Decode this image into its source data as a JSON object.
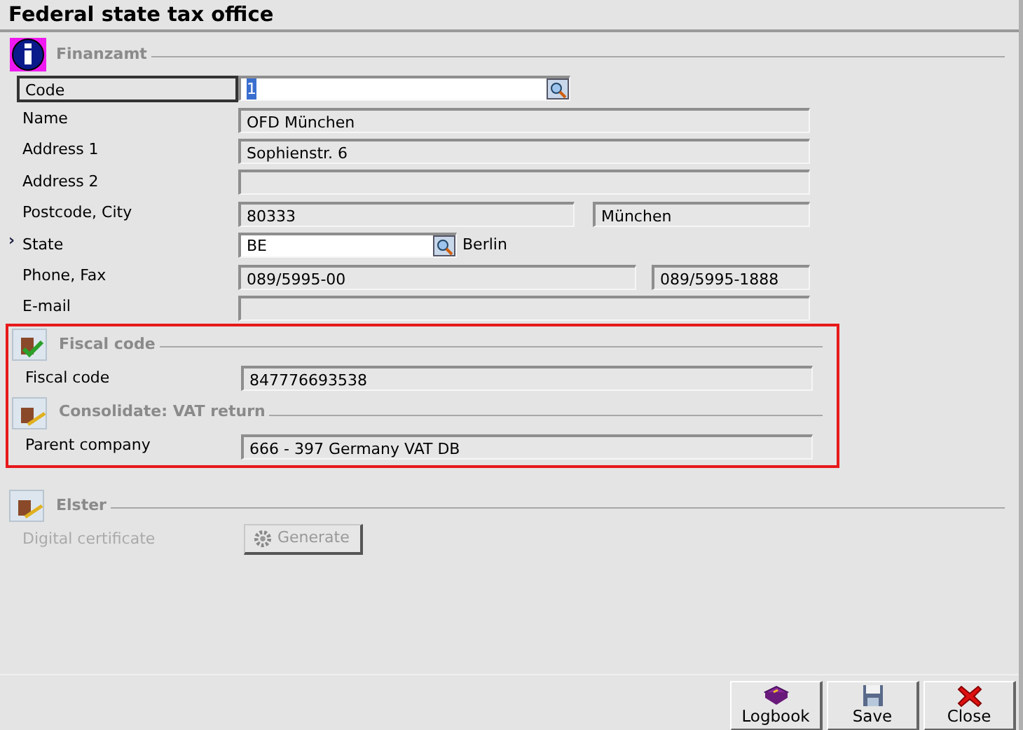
{
  "window": {
    "title": "Federal state tax office"
  },
  "sections": [
    {
      "title": "Finanzamt",
      "kind": "info",
      "highlighted": false,
      "rows": [
        {
          "label": "Code",
          "focused": true,
          "fields": [
            {
              "kind": "lookup",
              "value": "1",
              "text_selected": true
            }
          ]
        },
        {
          "label": "Name",
          "focused": false,
          "fields": [
            {
              "kind": "text",
              "value": "OFD München"
            }
          ]
        },
        {
          "label": "Address 1",
          "focused": false,
          "fields": [
            {
              "kind": "text",
              "value": "Sophienstr. 6"
            }
          ]
        },
        {
          "label": "Address 2",
          "focused": false,
          "fields": [
            {
              "kind": "text"
            }
          ]
        },
        {
          "label": "Postcode, City",
          "focused": false,
          "fields": [
            {
              "kind": "text",
              "value": "80333"
            },
            {
              "kind": "wide-second",
              "value": "München"
            }
          ]
        },
        {
          "label": "State",
          "marker": "›",
          "focused": false,
          "fields": [
            {
              "kind": "lookup-short",
              "value": "BE",
              "text_selected": false
            },
            {
              "kind": "description",
              "value": "Berlin"
            }
          ]
        },
        {
          "label": "Phone, Fax",
          "focused": false,
          "fields": [
            {
              "kind": "text",
              "value": "089/5995-00"
            },
            {
              "kind": "second",
              "value": "089/5995-1888"
            }
          ]
        },
        {
          "label": "E-mail",
          "focused": false,
          "fields": [
            {
              "kind": "text"
            }
          ]
        }
      ]
    },
    {
      "title": "Fiscal code",
      "kind": "check",
      "highlighted": true,
      "rows": [
        {
          "label": "Fiscal code",
          "focused": false,
          "fields": [
            {
              "kind": "text",
              "value": "847776693538"
            }
          ]
        }
      ]
    },
    {
      "title": "Consolidate: VAT return",
      "kind": "document",
      "highlighted": true,
      "rows": [
        {
          "label": "Parent company",
          "focused": false,
          "fields": [
            {
              "kind": "text",
              "value": "666 - 397 Germany VAT DB"
            }
          ]
        }
      ]
    },
    {
      "title": "Elster",
      "kind": "document",
      "highlighted": false,
      "rows": [
        {
          "label": "Digital certificate",
          "focused": false,
          "disabled": true,
          "fields": [
            {
              "kind": "button",
              "value": "Generate",
              "disabled": true
            }
          ]
        }
      ]
    }
  ],
  "buttons": [
    {
      "kind": "logbook",
      "label": "Logbook"
    },
    {
      "kind": "save",
      "label": "Save"
    },
    {
      "kind": "close",
      "label": "Close"
    }
  ]
}
